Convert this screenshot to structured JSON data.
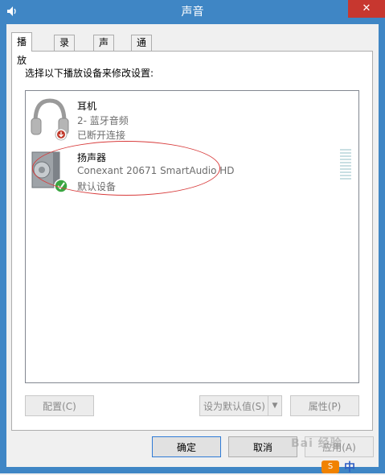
{
  "window": {
    "title": "声音",
    "close_glyph": "✕",
    "icon": "speaker-icon"
  },
  "tabs": [
    {
      "label": "播放",
      "active": true
    },
    {
      "label": "录制",
      "active": false
    },
    {
      "label": "声音",
      "active": false
    },
    {
      "label": "通信",
      "active": false
    }
  ],
  "instruction": "选择以下播放设备来修改设置:",
  "devices": [
    {
      "name": "耳机",
      "line1": "2- 蓝牙音频",
      "line2": "已断开连接",
      "icon": "headphones-icon",
      "status_icon": "disconnected-down-arrow-icon"
    },
    {
      "name": "扬声器",
      "line1": "Conexant 20671 SmartAudio HD",
      "line2": "默认设备",
      "icon": "speaker-icon",
      "status_icon": "default-check-icon"
    }
  ],
  "buttons": {
    "configure": "配置(C)",
    "set_default": "设为默认值(S)",
    "properties": "属性(P)",
    "ok": "确定",
    "cancel": "取消",
    "apply": "应用(A)"
  },
  "watermark": "Bai 经验",
  "baidu": {
    "logo_text": "S",
    "text": "中"
  },
  "colors": {
    "titlebar": "#3f86c5",
    "close": "#c7372f",
    "highlight": "#d83b3b",
    "check": "#3aa641"
  }
}
